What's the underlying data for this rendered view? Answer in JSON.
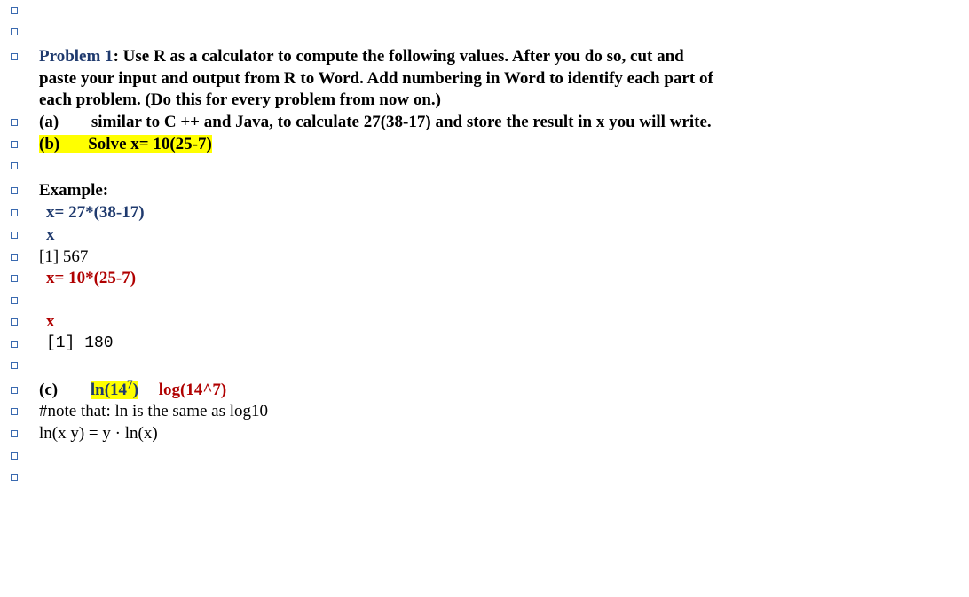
{
  "problem": {
    "label": "Problem 1",
    "text": ": Use R as a calculator to compute the following values.  After you do so, cut and paste your input and output from R to Word.  Add numbering in Word to identify each part of each problem.  (Do this for every problem from now on.)"
  },
  "parts": {
    "a": {
      "label": "(a)",
      "text": "similar to C ++ and Java, to calculate 27(38-17) and store the result in x you will write."
    },
    "b": {
      "label": "(b)",
      "text": "Solve x= 10(25-7)"
    },
    "c": {
      "label": "(c)",
      "ln_prefix": "ln(14",
      "ln_sup": "7",
      "ln_suffix": ")",
      "log": "log(14^7)"
    }
  },
  "example": {
    "header": "Example:",
    "line1": "x= 27*(38-17)",
    "line2": "x",
    "line3": "[1] 567",
    "line4": "x= 10*(25-7)",
    "line5": "x",
    "line6": "[1] 180"
  },
  "notes": {
    "n1": "#note that: ln is the same as log10",
    "n2": "ln(x y) = y · ln(x)"
  }
}
